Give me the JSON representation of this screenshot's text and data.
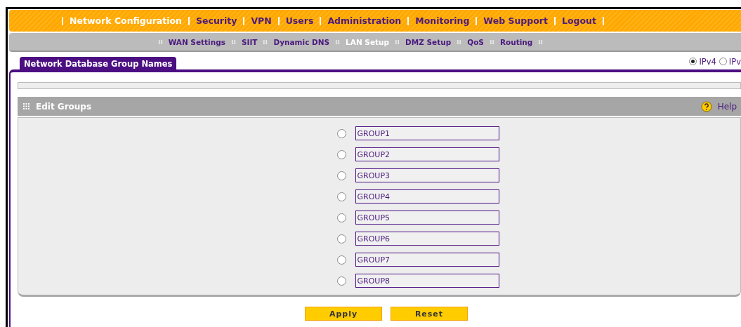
{
  "main_menu": [
    {
      "label": "Network Configuration",
      "selected": true
    },
    {
      "label": "Security",
      "selected": false
    },
    {
      "label": "VPN",
      "selected": false
    },
    {
      "label": "Users",
      "selected": false
    },
    {
      "label": "Administration",
      "selected": false
    },
    {
      "label": "Monitoring",
      "selected": false
    },
    {
      "label": "Web Support",
      "selected": false
    },
    {
      "label": "Logout",
      "selected": false
    }
  ],
  "sub_menu": [
    {
      "label": "WAN Settings",
      "selected": false
    },
    {
      "label": "SIIT",
      "selected": false
    },
    {
      "label": "Dynamic DNS",
      "selected": false
    },
    {
      "label": "LAN Setup",
      "selected": true
    },
    {
      "label": "DMZ Setup",
      "selected": false
    },
    {
      "label": "QoS",
      "selected": false
    },
    {
      "label": "Routing",
      "selected": false
    }
  ],
  "page_tab": "Network Database Group Names",
  "ip_mode": [
    {
      "label": "IPv4",
      "selected": true
    },
    {
      "label": "IPv",
      "selected": false
    }
  ],
  "section": {
    "title": "Edit Groups",
    "help": "Help"
  },
  "groups": [
    {
      "value": "GROUP1",
      "selected": false
    },
    {
      "value": "GROUP2",
      "selected": false
    },
    {
      "value": "GROUP3",
      "selected": false
    },
    {
      "value": "GROUP4",
      "selected": false
    },
    {
      "value": "GROUP5",
      "selected": false
    },
    {
      "value": "GROUP6",
      "selected": false
    },
    {
      "value": "GROUP7",
      "selected": false
    },
    {
      "value": "GROUP8",
      "selected": false
    }
  ],
  "buttons": [
    "Apply",
    "Reset"
  ]
}
